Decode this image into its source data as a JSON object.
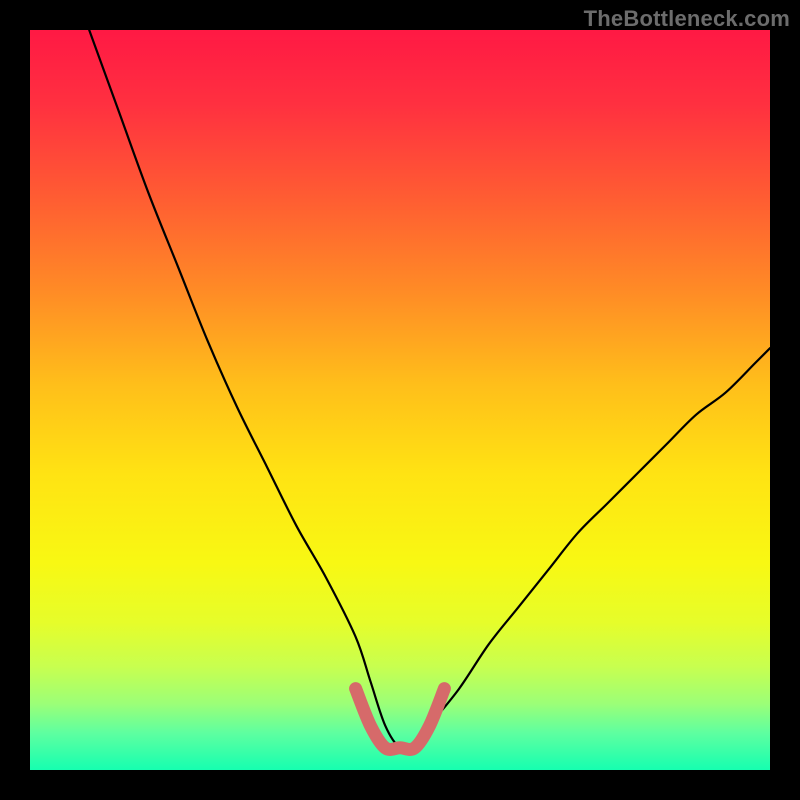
{
  "watermark": "TheBottleneck.com",
  "colors": {
    "frame": "#000000",
    "watermark": "#6c6c6c",
    "curve": "#000000",
    "marker": "#d66a6a",
    "gradient_stops": [
      {
        "offset": 0.0,
        "color": "#ff1944"
      },
      {
        "offset": 0.1,
        "color": "#ff3040"
      },
      {
        "offset": 0.22,
        "color": "#ff5a33"
      },
      {
        "offset": 0.35,
        "color": "#ff8a26"
      },
      {
        "offset": 0.48,
        "color": "#ffbf1a"
      },
      {
        "offset": 0.6,
        "color": "#ffe313"
      },
      {
        "offset": 0.72,
        "color": "#f8f813"
      },
      {
        "offset": 0.8,
        "color": "#e6fd2a"
      },
      {
        "offset": 0.86,
        "color": "#c8ff4f"
      },
      {
        "offset": 0.91,
        "color": "#9cff77"
      },
      {
        "offset": 0.95,
        "color": "#5effa0"
      },
      {
        "offset": 1.0,
        "color": "#16ffb0"
      }
    ]
  },
  "chart_data": {
    "type": "line",
    "title": "",
    "xlabel": "",
    "ylabel": "",
    "xlim": [
      0,
      100
    ],
    "ylim": [
      0,
      100
    ],
    "series": [
      {
        "name": "bottleneck-curve",
        "x": [
          8,
          12,
          16,
          20,
          24,
          28,
          32,
          36,
          40,
          44,
          46,
          48,
          50,
          52,
          54,
          58,
          62,
          66,
          70,
          74,
          78,
          82,
          86,
          90,
          94,
          98,
          100
        ],
        "y": [
          100,
          89,
          78,
          68,
          58,
          49,
          41,
          33,
          26,
          18,
          12,
          6,
          3,
          3,
          6,
          11,
          17,
          22,
          27,
          32,
          36,
          40,
          44,
          48,
          51,
          55,
          57
        ]
      }
    ],
    "annotations": [
      {
        "name": "valley-marker",
        "x": [
          44,
          46,
          48,
          50,
          52,
          54,
          56
        ],
        "y": [
          11,
          6,
          3,
          3,
          3,
          6,
          11
        ]
      }
    ]
  }
}
